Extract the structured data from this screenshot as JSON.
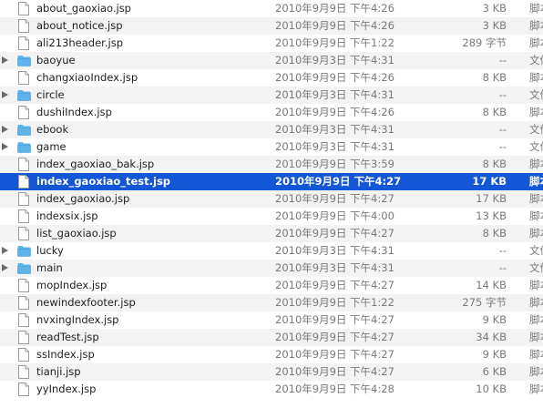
{
  "files": [
    {
      "name": "about_gaoxiao.jsp",
      "date": "2010年9月9日 下午4:26",
      "size": "3 KB",
      "kind": "脚本",
      "type": "file"
    },
    {
      "name": "about_notice.jsp",
      "date": "2010年9月9日 下午4:26",
      "size": "3 KB",
      "kind": "脚本",
      "type": "file"
    },
    {
      "name": "ali213header.jsp",
      "date": "2010年9月9日 下午1:22",
      "size": "289 字节",
      "kind": "脚本",
      "type": "file"
    },
    {
      "name": "baoyue",
      "date": "2010年9月3日 下午4:31",
      "size": "--",
      "kind": "文件",
      "type": "folder"
    },
    {
      "name": "changxiaoIndex.jsp",
      "date": "2010年9月9日 下午4:26",
      "size": "8 KB",
      "kind": "脚本",
      "type": "file"
    },
    {
      "name": "circle",
      "date": "2010年9月3日 下午4:31",
      "size": "--",
      "kind": "文件",
      "type": "folder"
    },
    {
      "name": "dushiIndex.jsp",
      "date": "2010年9月9日 下午4:26",
      "size": "8 KB",
      "kind": "脚本",
      "type": "file"
    },
    {
      "name": "ebook",
      "date": "2010年9月3日 下午4:31",
      "size": "--",
      "kind": "文件",
      "type": "folder"
    },
    {
      "name": "game",
      "date": "2010年9月3日 下午4:31",
      "size": "--",
      "kind": "文件",
      "type": "folder"
    },
    {
      "name": "index_gaoxiao_bak.jsp",
      "date": "2010年9月9日 下午3:59",
      "size": "8 KB",
      "kind": "脚本",
      "type": "file"
    },
    {
      "name": "index_gaoxiao_test.jsp",
      "date": "2010年9月9日 下午4:27",
      "size": "17 KB",
      "kind": "脚本",
      "type": "file",
      "selected": true
    },
    {
      "name": "index_gaoxiao.jsp",
      "date": "2010年9月9日 下午4:27",
      "size": "17 KB",
      "kind": "脚本",
      "type": "file"
    },
    {
      "name": "indexsix.jsp",
      "date": "2010年9月9日 下午4:00",
      "size": "13 KB",
      "kind": "脚本",
      "type": "file"
    },
    {
      "name": "list_gaoxiao.jsp",
      "date": "2010年9月9日 下午4:27",
      "size": "8 KB",
      "kind": "脚本",
      "type": "file"
    },
    {
      "name": "lucky",
      "date": "2010年9月3日 下午4:31",
      "size": "--",
      "kind": "文件",
      "type": "folder"
    },
    {
      "name": "main",
      "date": "2010年9月3日 下午4:31",
      "size": "--",
      "kind": "文件",
      "type": "folder"
    },
    {
      "name": "mopIndex.jsp",
      "date": "2010年9月9日 下午4:27",
      "size": "14 KB",
      "kind": "脚本",
      "type": "file"
    },
    {
      "name": "newindexfooter.jsp",
      "date": "2010年9月9日 下午1:22",
      "size": "275 字节",
      "kind": "脚本",
      "type": "file"
    },
    {
      "name": "nvxingIndex.jsp",
      "date": "2010年9月9日 下午4:27",
      "size": "9 KB",
      "kind": "脚本",
      "type": "file"
    },
    {
      "name": "readTest.jsp",
      "date": "2010年9月9日 下午4:27",
      "size": "34 KB",
      "kind": "脚本",
      "type": "file"
    },
    {
      "name": "ssIndex.jsp",
      "date": "2010年9月9日 下午4:27",
      "size": "9 KB",
      "kind": "脚本",
      "type": "file"
    },
    {
      "name": "tianji.jsp",
      "date": "2010年9月9日 下午4:27",
      "size": "6 KB",
      "kind": "脚本",
      "type": "file"
    },
    {
      "name": "yyIndex.jsp",
      "date": "2010年9月9日 下午4:28",
      "size": "10 KB",
      "kind": "脚本",
      "type": "file"
    }
  ],
  "colors": {
    "selection": "#1357d6",
    "stripe": "#f3f3f3",
    "folder": "#5fb3ec"
  },
  "icons": {
    "file": "document-icon",
    "folder": "folder-icon",
    "disclosure": "disclosure-triangle-icon"
  }
}
